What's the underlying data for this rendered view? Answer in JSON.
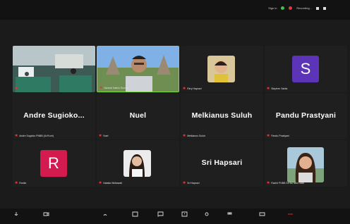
{
  "topbar": {
    "sign_in": "Sign in",
    "recording": "Recording..."
  },
  "participants": [
    {
      "label": "",
      "big": "",
      "kind": "room"
    },
    {
      "label": "Samuel Nainiu Sumba",
      "big": "",
      "kind": "man"
    },
    {
      "label": "Rirry Hapsari",
      "big": "",
      "kind": "child"
    },
    {
      "label": "Stephen Sarita",
      "big": "",
      "kind": "letter",
      "letter": "S",
      "color": "#5b34b8"
    },
    {
      "label": "Andre Sugioko PNBB (Ur/Kurir)",
      "big": "Andre  Sugioko...",
      "kind": "name"
    },
    {
      "label": "Nuel",
      "big": "Nuel",
      "kind": "name"
    },
    {
      "label": "Melkianus Suluh",
      "big": "Melkianus Suluh",
      "kind": "name"
    },
    {
      "label": "Pandu Prastyani",
      "big": "Pandu Prastyani",
      "kind": "name"
    },
    {
      "label": "Ronila",
      "big": "",
      "kind": "letter",
      "letter": "R",
      "color": "#d31b4f"
    },
    {
      "label": "Natalia Widiawati",
      "big": "",
      "kind": "woman"
    },
    {
      "label": "Sri Hapsari",
      "big": "Sri Hapsari",
      "kind": "name"
    },
    {
      "label": "Rachli PNBB Sri Bu Nita Liata",
      "big": "",
      "kind": "woman2"
    }
  ],
  "toolbar": [
    "Audio",
    "Video",
    "Participants",
    "Share",
    "Chat",
    "Share Screen",
    "Record",
    "Reactions",
    "Apps",
    "Leave"
  ]
}
